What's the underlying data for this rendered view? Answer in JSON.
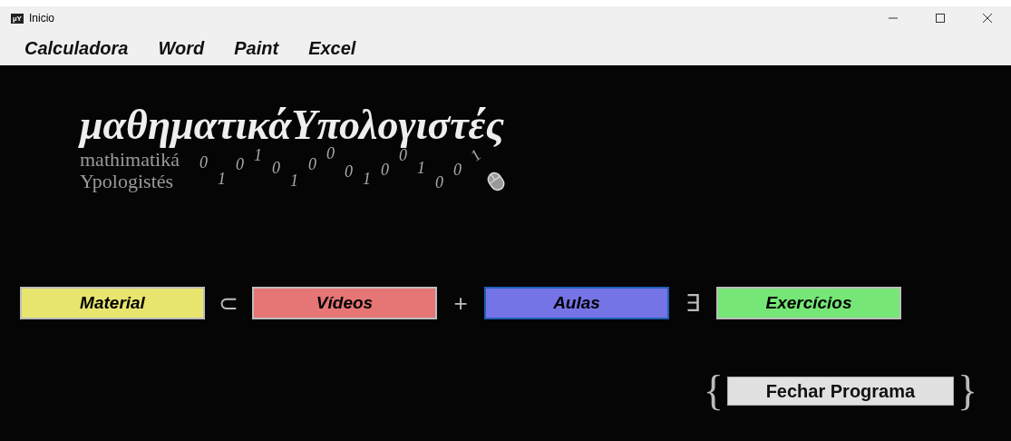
{
  "window": {
    "icon": "µY",
    "title": "Inicio"
  },
  "menu": [
    "Calculadora",
    "Word",
    "Paint",
    "Excel"
  ],
  "logo": {
    "title": "μαθηματικάΥπολογιστές",
    "subtitle_lines": [
      "mathimatiká",
      "Ypologistés"
    ],
    "digits": [
      "0",
      "1",
      "0",
      "1",
      "0",
      "1",
      "0",
      "0",
      "0",
      "1",
      "0",
      "0",
      "1",
      "0",
      "0",
      "1"
    ]
  },
  "sections": [
    {
      "kind": "button",
      "label": "Material",
      "color": "#e8e56f",
      "selected": false
    },
    {
      "kind": "operator",
      "label": "⊂"
    },
    {
      "kind": "button",
      "label": "Vídeos",
      "color": "#e67575",
      "selected": false
    },
    {
      "kind": "operator",
      "label": "+"
    },
    {
      "kind": "button",
      "label": "Aulas",
      "color": "#7474e6",
      "selected": true
    },
    {
      "kind": "operator",
      "label": "∃"
    },
    {
      "kind": "button",
      "label": "Exercícios",
      "color": "#76e676",
      "selected": false
    }
  ],
  "close_button": {
    "open_brace": "{",
    "label": "Fechar Programa",
    "close_brace": "}"
  }
}
